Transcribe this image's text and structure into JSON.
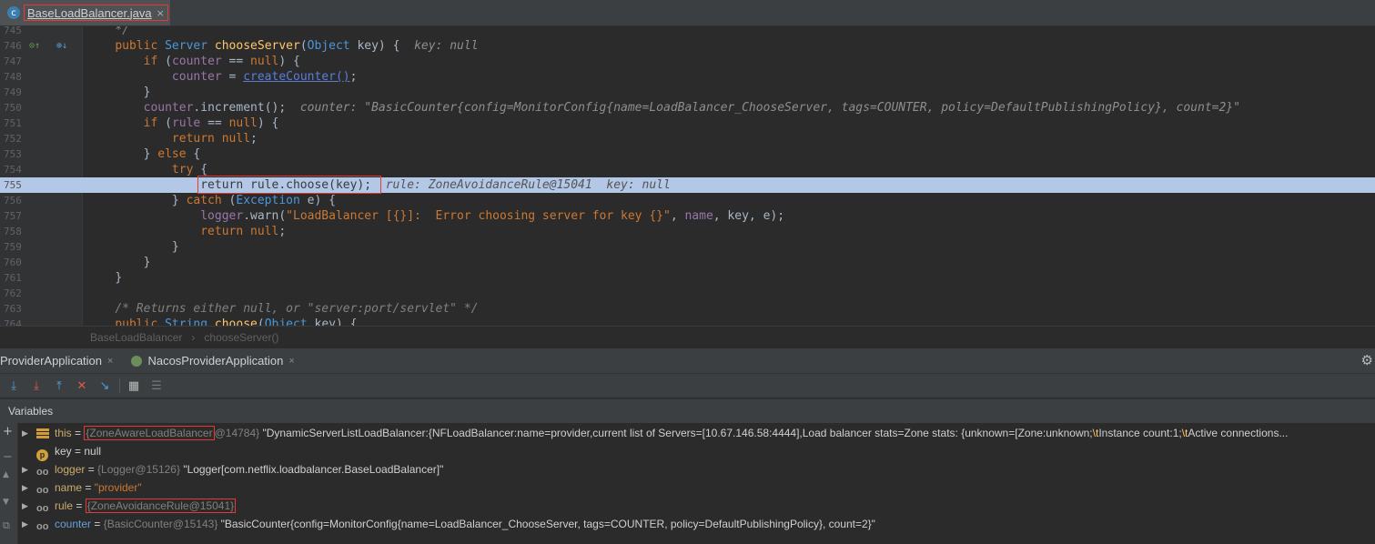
{
  "tab": {
    "file_name": "BaseLoadBalancer.java",
    "close_label": "×"
  },
  "lines": [
    {
      "n": "745",
      "text": "    */"
    },
    {
      "n": "746"
    },
    {
      "n": "747"
    },
    {
      "n": "748"
    },
    {
      "n": "749"
    },
    {
      "n": "750"
    },
    {
      "n": "751"
    },
    {
      "n": "752"
    },
    {
      "n": "753"
    },
    {
      "n": "754"
    },
    {
      "n": "755"
    },
    {
      "n": "756"
    },
    {
      "n": "757"
    },
    {
      "n": "758"
    },
    {
      "n": "759"
    },
    {
      "n": "760"
    },
    {
      "n": "761"
    },
    {
      "n": "762"
    },
    {
      "n": "763"
    },
    {
      "n": "764"
    }
  ],
  "code": {
    "l746_a": "public ",
    "l746_type": "Server ",
    "l746_fn": "chooseServer",
    "l746_b": "(",
    "l746_param_type": "Object ",
    "l746_c": "key) {  ",
    "l746_debug": "key: null",
    "l747_kw": "if ",
    "l747_a": "(",
    "l747_field": "counter",
    "l747_b": " == ",
    "l747_null": "null",
    "l747_c": ") {",
    "l748_field": "counter",
    "l748_a": " = ",
    "l748_link": "createCounter()",
    "l748_b": ";",
    "l749": "}",
    "l750_field": "counter",
    "l750_a": ".increment();  ",
    "l750_debug": "counter: \"BasicCounter{config=MonitorConfig{name=LoadBalancer_ChooseServer, tags=COUNTER, policy=DefaultPublishingPolicy}, count=2}\"",
    "l751_kw": "if ",
    "l751_a": "(",
    "l751_field": "rule",
    "l751_b": " == ",
    "l751_null": "null",
    "l751_c": ") {",
    "l752_kw": "return ",
    "l752_null": "null",
    "l752_a": ";",
    "l753_a": "} ",
    "l753_kw": "else ",
    "l753_b": "{",
    "l754_kw": "try ",
    "l754_a": "{",
    "l755_code": "return rule.choose(key);",
    "l755_debug": "rule: ZoneAvoidanceRule@15041  key: null",
    "l756_a": "} ",
    "l756_kw": "catch ",
    "l756_b": "(",
    "l756_type": "Exception ",
    "l756_c": "e) {",
    "l757_field": "logger",
    "l757_a": ".warn(",
    "l757_str": "\"LoadBalancer [{}]:  Error choosing server for key {}\"",
    "l757_b": ", ",
    "l757_name": "name",
    "l757_c": ", key, e);",
    "l758_kw": "return ",
    "l758_null": "null",
    "l758_a": ";",
    "l759": "}",
    "l760": "}",
    "l761": "}",
    "l763": "/* Returns either null, or \"server:port/servlet\" */",
    "l764_a": "public ",
    "l764_type": "String ",
    "l764_fn": "choose",
    "l764_b": "(",
    "l764_param_type": "Object ",
    "l764_c": "key) {"
  },
  "breadcrumb": {
    "class_name": "BaseLoadBalancer",
    "sep": "›",
    "method": "chooseServer()"
  },
  "debug_tabs": [
    {
      "label": "ProviderApplication",
      "close": "×"
    },
    {
      "label": "NacosProviderApplication",
      "close": "×"
    }
  ],
  "toolbar_icons": [
    "step-over-icon",
    "step-into-icon",
    "force-step-into-icon",
    "step-out-icon",
    "drop-frame-icon",
    "run-to-cursor-icon",
    "evaluate-icon",
    "trace-icon"
  ],
  "variables_title": "Variables",
  "variables": [
    {
      "name": "this",
      "eq": " = ",
      "type_boxed": "{ZoneAwareLoadBalancer",
      "type_rest": "@14784}",
      "value": " \"DynamicServerListLoadBalancer:{NFLoadBalancer:name=provider,current list of Servers=[10.67.146.58:4444],Load balancer stats=Zone stats: {unknown=[Zone:unknown;",
      "tab1": "\\t",
      "value2": "Instance count:1;",
      "tab2": "\\t",
      "value3": "Active connections..."
    },
    {
      "name": "key",
      "eq": " = ",
      "value": "null"
    },
    {
      "name": "logger",
      "eq": " = ",
      "type": "{Logger@15126}",
      "value": " \"Logger[com.netflix.loadbalancer.BaseLoadBalancer]\""
    },
    {
      "name": "name",
      "eq": " = ",
      "value": "\"provider\""
    },
    {
      "name": "rule",
      "eq": " = ",
      "type_boxed": "{ZoneAvoidanceRule@15041}"
    },
    {
      "name": "counter",
      "eq": " = ",
      "type": "{BasicCounter@15143}",
      "value": " \"BasicCounter{config=MonitorConfig{name=LoadBalancer_ChooseServer, tags=COUNTER, policy=DefaultPublishingPolicy}, count=2}\""
    }
  ],
  "colors": {
    "highlight_line": "#b3c7e7",
    "annotation_box": "#e53935",
    "keyword": "#cc7832"
  }
}
